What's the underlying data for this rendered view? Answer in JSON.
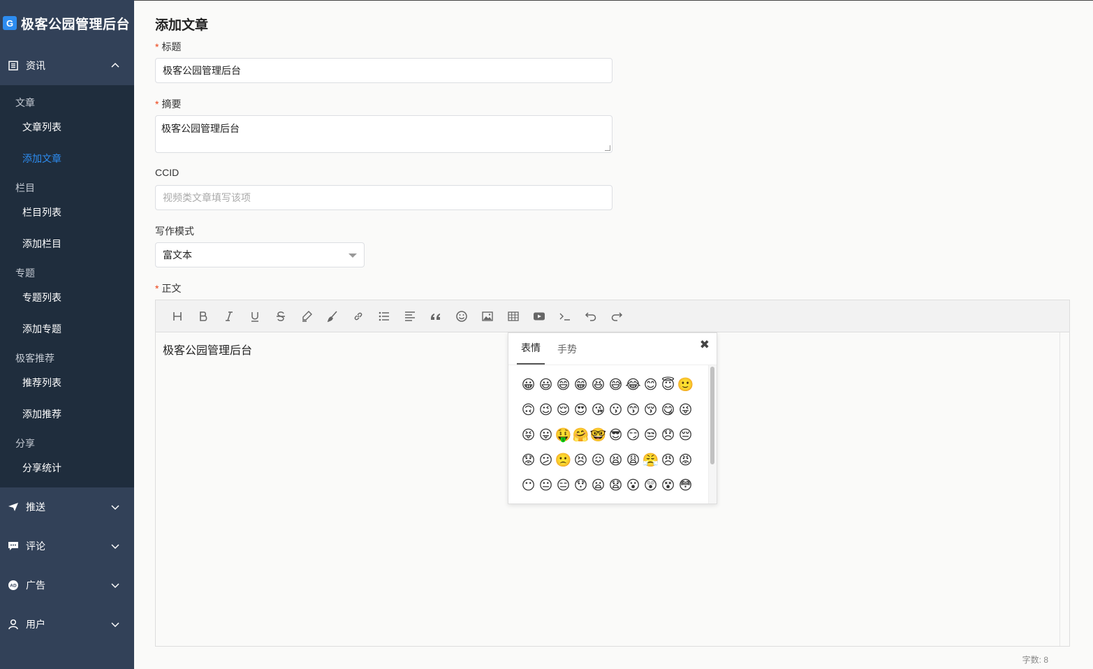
{
  "brand": {
    "logo_letter": "G",
    "title": "极客公园管理后台"
  },
  "sidebar": {
    "groups": [
      {
        "label": "资讯",
        "icon": "document-icon",
        "expanded": true
      },
      {
        "label": "推送",
        "icon": "paper-plane-icon",
        "expanded": false
      },
      {
        "label": "评论",
        "icon": "comment-icon",
        "expanded": false
      },
      {
        "label": "广告",
        "icon": "ad-icon",
        "expanded": false
      },
      {
        "label": "用户",
        "icon": "user-icon",
        "expanded": false
      }
    ],
    "sections": [
      {
        "title": "文章",
        "items": [
          "文章列表",
          "添加文章"
        ]
      },
      {
        "title": "栏目",
        "items": [
          "栏目列表",
          "添加栏目"
        ]
      },
      {
        "title": "专题",
        "items": [
          "专题列表",
          "添加专题"
        ]
      },
      {
        "title": "极客推荐",
        "items": [
          "推荐列表",
          "添加推荐"
        ]
      },
      {
        "title": "分享",
        "items": [
          "分享统计"
        ]
      }
    ],
    "active_item": "添加文章"
  },
  "page": {
    "title": "添加文章",
    "title_field": {
      "label": "标题",
      "required": true,
      "value": "极客公园管理后台"
    },
    "summary_field": {
      "label": "摘要",
      "required": true,
      "value": "极客公园管理后台"
    },
    "ccid_field": {
      "label": "CCID",
      "required": false,
      "placeholder": "视频类文章填写该项"
    },
    "mode_field": {
      "label": "写作模式",
      "value": "富文本"
    },
    "body_field": {
      "label": "正文",
      "required": true,
      "content": "极客公园管理后台"
    },
    "required_mark": "*",
    "word_count": "字数: 8"
  },
  "emoji_popover": {
    "tabs": [
      "表情",
      "手势"
    ],
    "active_tab": "表情",
    "close": "✖",
    "emojis": [
      "😀",
      "😃",
      "😄",
      "😁",
      "😆",
      "😅",
      "😂",
      "😊",
      "😇",
      "🙂",
      "🙃",
      "😉",
      "😌",
      "😍",
      "😘",
      "😗",
      "😙",
      "😚",
      "😋",
      "😜",
      "😝",
      "😛",
      "🤑",
      "🤗",
      "🤓",
      "😎",
      "😏",
      "😒",
      "😞",
      "😔",
      "😟",
      "😕",
      "🙁",
      "😣",
      "😖",
      "😫",
      "😩",
      "😤",
      "😠",
      "😡",
      "😶",
      "😐",
      "😑",
      "😯",
      "😦",
      "😧",
      "😮",
      "😲",
      "😵",
      "😳"
    ]
  },
  "toolbar": [
    "heading-icon",
    "bold-icon",
    "italic-icon",
    "underline-icon",
    "strikethrough-icon",
    "highlighter-icon",
    "brush-icon",
    "link-icon",
    "bullet-list-icon",
    "align-icon",
    "quote-icon",
    "emoji-icon",
    "image-icon",
    "table-icon",
    "video-icon",
    "code-icon",
    "undo-icon",
    "redo-icon"
  ],
  "colors": {
    "sidebar_bg": "#324158",
    "submenu_bg": "#1f2d3d",
    "accent": "#2d8cf0",
    "required": "#ed4014"
  }
}
